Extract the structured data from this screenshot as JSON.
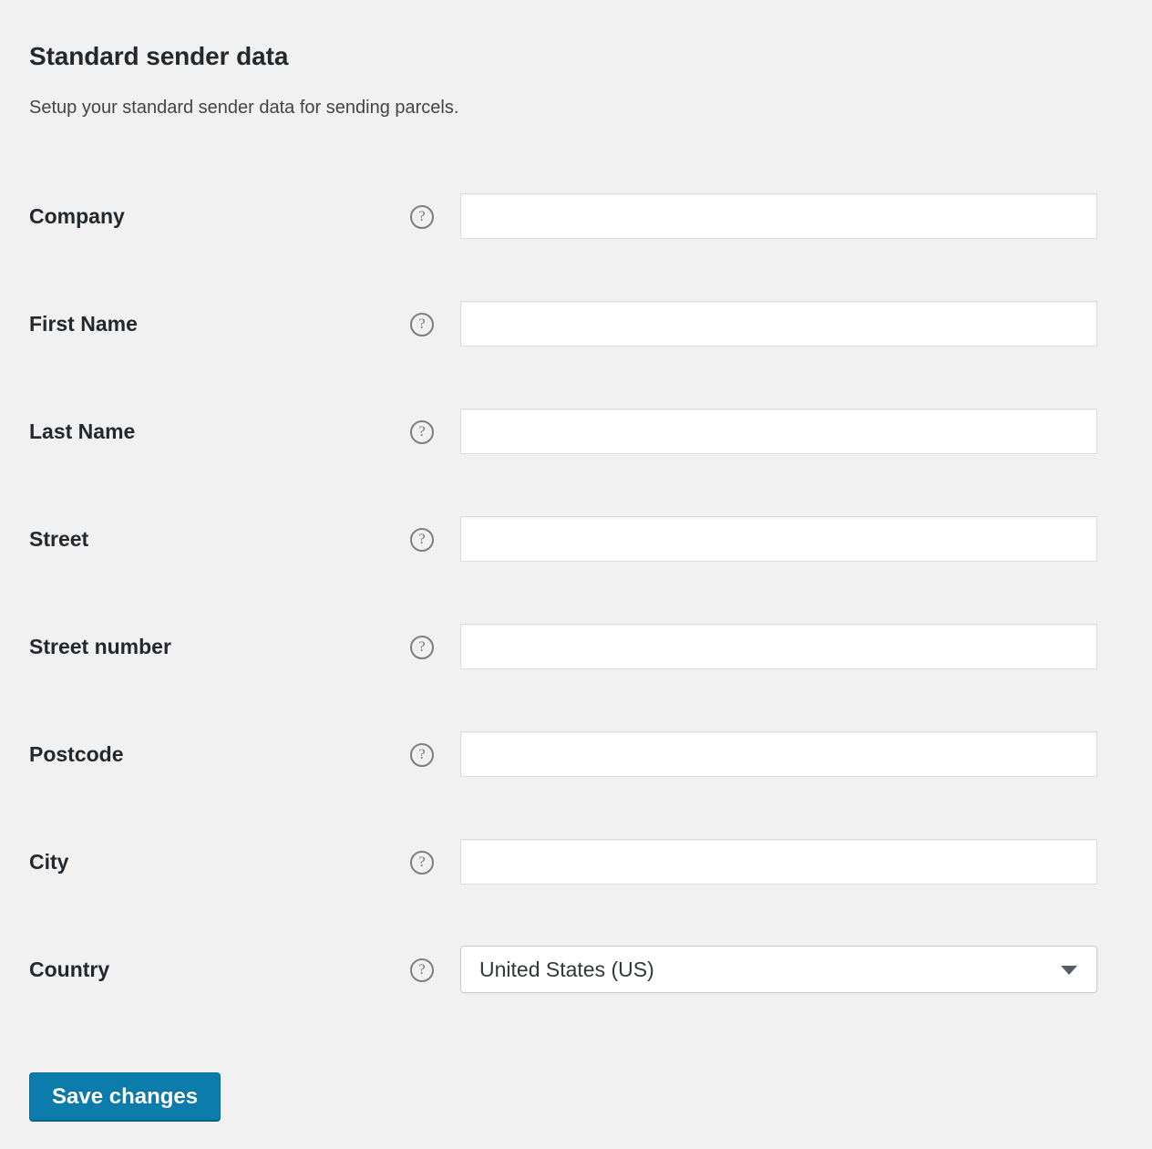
{
  "page": {
    "title": "Standard sender data",
    "description": "Setup your standard sender data for sending parcels."
  },
  "icons": {
    "help": "?",
    "help_name": "help-tip-icon"
  },
  "form": {
    "rows": [
      {
        "label": "Company",
        "type": "text",
        "value": "",
        "placeholder": ""
      },
      {
        "label": "First Name",
        "type": "text",
        "value": "",
        "placeholder": ""
      },
      {
        "label": "Last Name",
        "type": "text",
        "value": "",
        "placeholder": ""
      },
      {
        "label": "Street",
        "type": "text",
        "value": "",
        "placeholder": ""
      },
      {
        "label": "Street number",
        "type": "text",
        "value": "",
        "placeholder": ""
      },
      {
        "label": "Postcode",
        "type": "text",
        "value": "",
        "placeholder": ""
      },
      {
        "label": "City",
        "type": "text",
        "value": "",
        "placeholder": ""
      },
      {
        "label": "Country",
        "type": "select",
        "value": "United States (US)",
        "placeholder": ""
      }
    ]
  },
  "actions": {
    "save_label": "Save changes"
  },
  "colors": {
    "background": "#f1f1f1",
    "label_text": "#23282d",
    "description_text": "#444444",
    "input_border": "#dddddd",
    "button_background": "#0b7cab",
    "button_text": "#ffffff"
  }
}
